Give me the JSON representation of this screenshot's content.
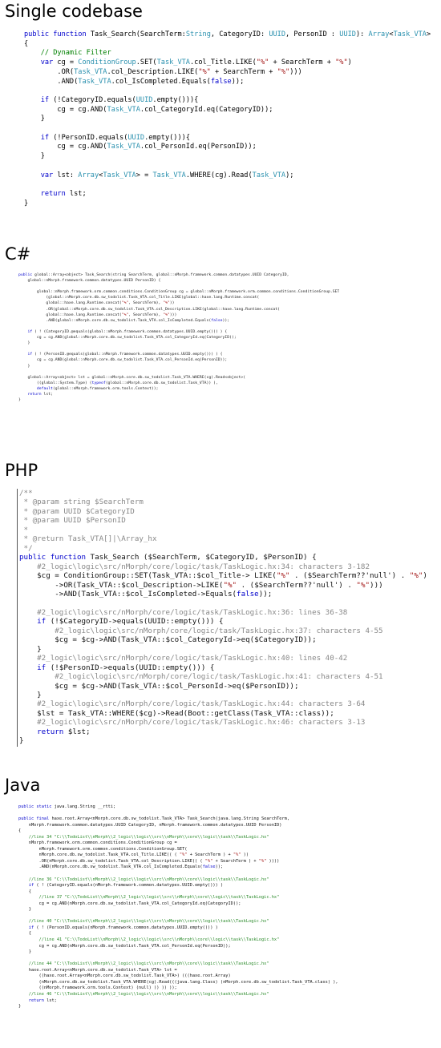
{
  "sections": [
    {
      "title": "Single codebase",
      "lines": [
        "public function Task_Search(SearchTerm:String, CategoryID: UUID, PersonID : UUID): Array<Task_VTA>",
        "{",
        "    // Dynamic Filter",
        "    var cg = ConditionGroup.SET(Task_VTA.col_Title.LIKE(\"%\" + SearchTerm + \"%\")",
        "        .OR(Task_VTA.col_Description.LIKE(\"%\" + SearchTerm + \"%\")))",
        "        .AND(Task_VTA.col_IsCompleted.Equals(false));",
        "",
        "    if (!CategoryID.equals(UUID.empty())){",
        "        cg = cg.AND(Task_VTA.col_CategoryId.eq(CategoryID));",
        "    }",
        "",
        "    if (!PersonID.equals(UUID.empty())){",
        "        cg = cg.AND(Task_VTA.col_PersonId.eq(PersonID));",
        "    }",
        "",
        "    var lst: Array<Task_VTA> = Task_VTA.WHERE(cg).Read(Task_VTA);",
        "",
        "    return lst;",
        "}"
      ]
    },
    {
      "title": "C#",
      "lines": [
        "public global::Array<object> Task_Search(string SearchTerm, global::nMorph.framework.common.datatypes.UUID CategoryID,",
        "    global::nMorph.framework.common.datatypes.UUID PersonID) {",
        "",
        "        global::nMorph.framework.orm.common.conditions.ConditionGroup cg = global::nMorph.framework.orm.common.conditions.ConditionGroup.SET",
        "            (global::nMorph.core.db.sw_todolist.Task_VTA.col_Title.LIKE(global::haxe.lang.Runtime.concat(",
        "            global::haxe.lang.Runtime.concat(\"%\", SearchTerm), \"%\"))",
        "            .OR(global::nMorph.core.db.sw_todolist.Task_VTA.col_Description.LIKE(global::haxe.lang.Runtime.concat(",
        "            global::haxe.lang.Runtime.concat(\"%\", SearchTerm), \"%\")))",
        "            .AND(global::nMorph.core.db.sw_todolist.Task_VTA.col_IsCompleted.Equals(false));",
        "",
        "    if ( ! (CategoryID.@equals(global::nMorph.framework.common.datatypes.UUID.empty())) ) {",
        "        cg = cg.AND(global::nMorph.core.db.sw_todolist.Task_VTA.col_CategoryId.eq(CategoryID));",
        "    }",
        "",
        "    if ( ! (PersonID.@equals(global::nMorph.framework.common.datatypes.UUID.empty())) ) {",
        "        cg = cg.AND(global::nMorph.core.db.sw_todolist.Task_VTA.col_PersonId.eq(PersonID));",
        "    }",
        "",
        "    global::Array<object> lst = global::nMorph.core.db.sw_todolist.Task_VTA.WHERE(cg).Read<object>(",
        "        ((global::System.Type) (typeof(global::nMorph.core.db.sw_todolist.Task_VTA)) ),",
        "        default(global::nMorph.framework.orm.tools.Context));",
        "    return lst;",
        "}"
      ]
    },
    {
      "title": "PHP",
      "lines": [
        "/**",
        " * @param string $SearchTerm",
        " * @param UUID $CategoryID",
        " * @param UUID $PersonID",
        " *",
        " * @return Task_VTA[]|\\Array_hx",
        " */",
        "public function Task_Search ($SearchTerm, $CategoryID, $PersonID) {",
        "    #2_logic\\logic\\src/nMorph/core/logic/task/TaskLogic.hx:34: characters 3-182",
        "    $cg = ConditionGroup::SET(Task_VTA::$col_Title-> LIKE(\"%\" . ($SearchTerm??'null') . \"%\")",
        "        ->OR(Task_VTA::$col_Description->LIKE(\"%\" . ($SearchTerm??'null') . \"%\")))",
        "        ->AND(Task_VTA::$col_IsCompleted->Equals(false));",
        "",
        "    #2_logic\\logic\\src/nMorph/core/logic/task/TaskLogic.hx:36: lines 36-38",
        "    if (!$CategoryID->equals(UUID::empty())) {",
        "        #2_logic\\logic\\src/nMorph/core/logic/task/TaskLogic.hx:37: characters 4-55",
        "        $cg = $cg->AND(Task_VTA::$col_CategoryId->eq($CategoryID));",
        "    }",
        "    #2_logic\\logic\\src/nMorph/core/logic/task/TaskLogic.hx:40: lines 40-42",
        "    if (!$PersonID->equals(UUID::empty())) {",
        "        #2_logic\\logic\\src/nMorph/core/logic/task/TaskLogic.hx:41: characters 4-51",
        "        $cg = $cg->AND(Task_VTA::$col_PersonId->eq($PersonID));",
        "    }",
        "    #2_logic\\logic\\src/nMorph/core/logic/task/TaskLogic.hx:44: characters 3-64",
        "    $lst = Task_VTA::WHERE($cg)->Read(Boot::getClass(Task_VTA::class));",
        "    #2_logic\\logic\\src/nMorph/core/logic/task/TaskLogic.hx:46: characters 3-13",
        "    return $lst;",
        "}"
      ]
    },
    {
      "title": "Java",
      "lines": [
        "public static java.lang.String __rtti;",
        "",
        "public final haxe.root.Array<nMorph.core.db.sw_todolist.Task_VTA> Task_Search(java.lang.String SearchTerm,",
        "    nMorph.framework.common.datatypes.UUID CategoryID, nMorph.framework.common.datatypes.UUID PersonID)",
        "{",
        "    //line 34 \"C:\\\\TodoList\\\\nMorph\\\\2_logic\\\\logic\\\\src\\\\nMorph\\\\core\\\\logic\\\\task\\\\TaskLogic.hx\"",
        "    nMorph.framework.orm.common.conditions.ConditionGroup cg =",
        "        nMorph.framework.orm.common.conditions.ConditionGroup.SET(",
        "        nMorph.core.db.sw_todolist.Task_VTA.col_Title.LIKE(( ( \"%\" + SearchTerm ) + \"%\" ))",
        "        .OR(nMorph.core.db.sw_todolist.Task_VTA.col_Description.LIKE(( ( \"%\" + SearchTerm ) + \"%\" ))))",
        "        .AND(nMorph.core.db.sw_todolist.Task_VTA.col_IsCompleted.Equals(false));",
        "",
        "    //line 36 \"C:\\\\TodoList\\\\nMorph\\\\2_logic\\\\logic\\\\src\\\\nMorph\\\\core\\\\logic\\\\task\\\\TaskLogic.hx\"",
        "    if ( ! (CategoryID.equals(nMorph.framework.common.datatypes.UUID.empty())) )",
        "    {",
        "        //line 37 \"C:\\\\TodoList\\\\nMorph\\\\2_logic\\\\logic\\\\src\\\\nMorph\\\\core\\\\logic\\\\task\\\\TaskLogic.hx\"",
        "        cg = cg.AND(nMorph.core.db.sw_todolist.Task_VTA.col_CategoryId.eq(CategoryID));",
        "    }",
        "",
        "    //line 40 \"C:\\\\TodoList\\\\nMorph\\\\2_logic\\\\logic\\\\src\\\\nMorph\\\\core\\\\logic\\\\task\\\\TaskLogic.hx\"",
        "    if ( ! (PersonID.equals(nMorph.framework.common.datatypes.UUID.empty())) )",
        "    {",
        "        //line 41 \"C:\\\\TodoList\\\\nMorph\\\\2_logic\\\\logic\\\\src\\\\nMorph\\\\core\\\\logic\\\\task\\\\TaskLogic.hx\"",
        "        cg = cg.AND(nMorph.core.db.sw_todolist.Task_VTA.col_PersonId.eq(PersonID));",
        "    }",
        "",
        "    //line 44 \"C:\\\\TodoList\\\\nMorph\\\\2_logic\\\\logic\\\\src\\\\nMorph\\\\core\\\\logic\\\\task\\\\TaskLogic.hx\"",
        "    haxe.root.Array<nMorph.core.db.sw_todolist.Task_VTA> lst =",
        "        ((haxe.root.Array<nMorph.core.db.sw_todolist.Task_VTA>) (((haxe.root.Array)",
        "        (nMorph.core.db.sw_todolist.Task_VTA.WHERE(cg).Read(((java.lang.Class) (nMorph.core.db.sw_todolist.Task_VTA.class) ),",
        "        ((nMorph.framework.orm.tools.Context) (null) )) )) ));",
        "    //line 46 \"C:\\\\TodoList\\\\nMorph\\\\2_logic\\\\logic\\\\src\\\\nMorph\\\\core\\\\logic\\\\task\\\\TaskLogic.hx\"",
        "    return lst;",
        "}"
      ]
    }
  ]
}
